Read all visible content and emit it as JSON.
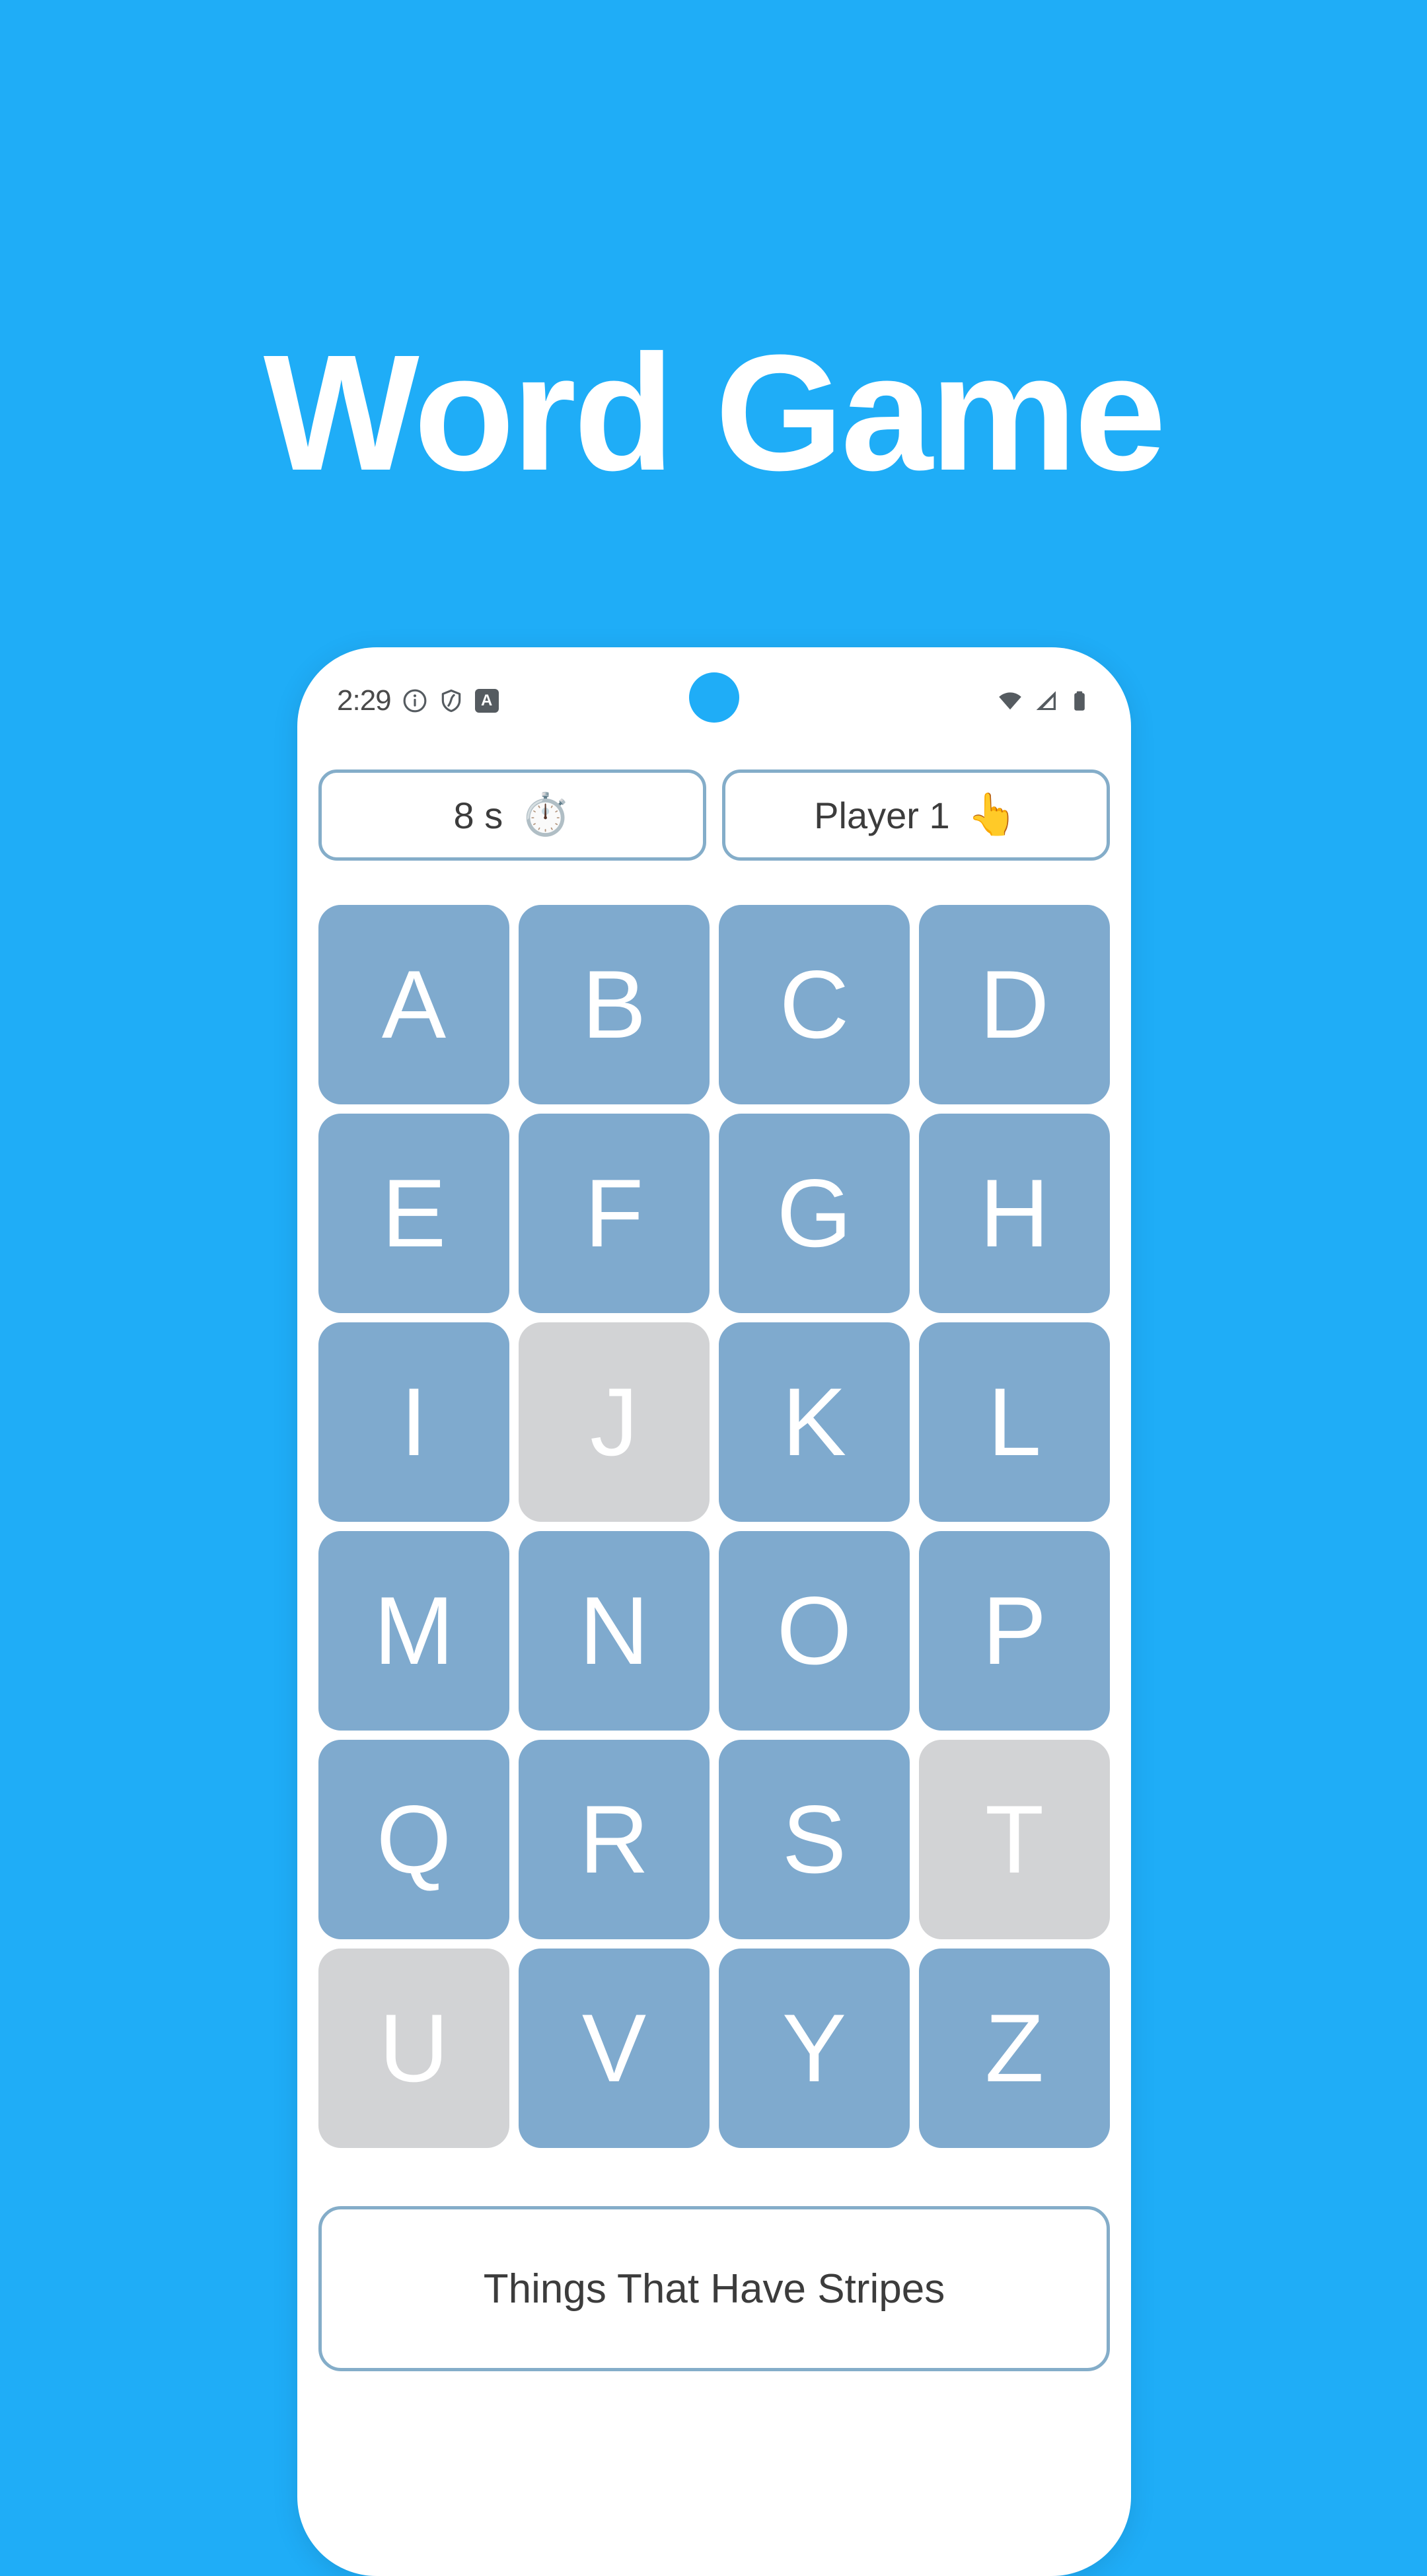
{
  "page": {
    "title": "Word Game",
    "background_color": "#1FADF7",
    "title_color": "#FFFFFF"
  },
  "phone": {
    "status_bar": {
      "time": "2:29",
      "left_icons": [
        "info-icon",
        "shield-icon",
        "a-badge-icon"
      ],
      "a_badge_letter": "A",
      "right_icons": [
        "wifi-icon",
        "cellular-signal-icon",
        "battery-icon"
      ],
      "camera": "front-camera-punch-hole"
    },
    "timer_card": {
      "label": "8 s",
      "emoji": "⏱️",
      "icon_name": "stopwatch-icon"
    },
    "player_card": {
      "label": "Player 1",
      "emoji": "👆",
      "icon_name": "tap-hand-icon"
    },
    "letter_grid": {
      "columns": 4,
      "active_color": "#7FAACE",
      "disabled_color": "#D2D3D5",
      "letter_color": "#FFFFFF",
      "tiles": [
        {
          "letter": "A",
          "state": "active"
        },
        {
          "letter": "B",
          "state": "active"
        },
        {
          "letter": "C",
          "state": "active"
        },
        {
          "letter": "D",
          "state": "active"
        },
        {
          "letter": "E",
          "state": "active"
        },
        {
          "letter": "F",
          "state": "active"
        },
        {
          "letter": "G",
          "state": "active"
        },
        {
          "letter": "H",
          "state": "active"
        },
        {
          "letter": "I",
          "state": "active"
        },
        {
          "letter": "J",
          "state": "disabled"
        },
        {
          "letter": "K",
          "state": "active"
        },
        {
          "letter": "L",
          "state": "active"
        },
        {
          "letter": "M",
          "state": "active"
        },
        {
          "letter": "N",
          "state": "active"
        },
        {
          "letter": "O",
          "state": "active"
        },
        {
          "letter": "P",
          "state": "active"
        },
        {
          "letter": "Q",
          "state": "active"
        },
        {
          "letter": "R",
          "state": "active"
        },
        {
          "letter": "S",
          "state": "active"
        },
        {
          "letter": "T",
          "state": "disabled"
        },
        {
          "letter": "U",
          "state": "disabled"
        },
        {
          "letter": "V",
          "state": "active"
        },
        {
          "letter": "Y",
          "state": "active"
        },
        {
          "letter": "Z",
          "state": "active"
        }
      ]
    },
    "category_card": {
      "label": "Things That Have Stripes"
    }
  }
}
